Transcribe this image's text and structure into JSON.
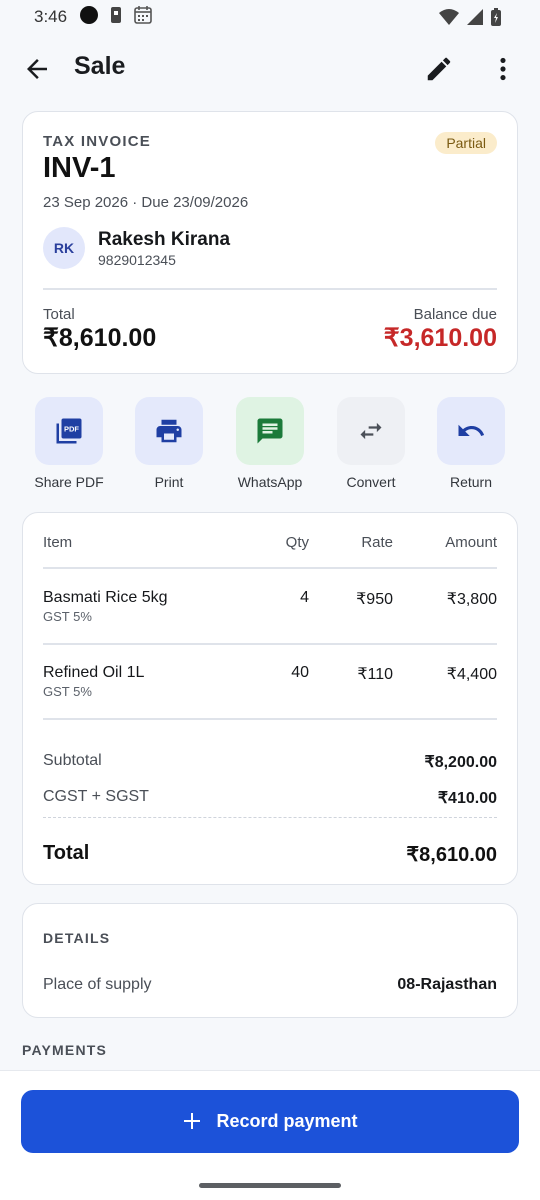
{
  "status_bar": {
    "time": "3:46",
    "icons": [
      "dot-icon",
      "sim-icon",
      "calendar-icon",
      "wifi-icon",
      "signal-icon",
      "battery-icon"
    ]
  },
  "app_bar": {
    "title": "Sale",
    "icons": [
      "back-arrow-icon",
      "pencil-icon",
      "more-vertical-icon"
    ]
  },
  "invoice": {
    "type_label": "TAX INVOICE",
    "status": "Partial",
    "number": "INV-1",
    "dates": "23 Sep 2026 · Due 23/09/2026",
    "customer": {
      "initials": "RK",
      "name": "Rakesh Kirana",
      "phone": "9829012345"
    },
    "total_label": "Total",
    "total_value": "₹8,610.00",
    "balance_label": "Balance due",
    "balance_value": "₹3,610.00"
  },
  "actions": [
    {
      "label": "Share PDF",
      "icon": "pdf-icon"
    },
    {
      "label": "Print",
      "icon": "printer-icon"
    },
    {
      "label": "WhatsApp",
      "icon": "chat-icon"
    },
    {
      "label": "Convert",
      "icon": "swap-icon"
    },
    {
      "label": "Return",
      "icon": "undo-icon"
    }
  ],
  "items_table": {
    "headers": [
      "Item",
      "Qty",
      "Rate",
      "Amount"
    ],
    "rows": [
      {
        "name": "Basmati Rice 5kg",
        "tax": "GST 5%",
        "qty": "4",
        "rate": "₹950",
        "amount": "₹3,800"
      },
      {
        "name": "Refined Oil 1L",
        "tax": "GST 5%",
        "qty": "40",
        "rate": "₹110",
        "amount": "₹4,400"
      }
    ],
    "subtotal_label": "Subtotal",
    "subtotal_value": "₹8,200.00",
    "tax_label": "CGST + SGST",
    "tax_value": "₹410.00",
    "total_label": "Total",
    "total_value": "₹8,610.00"
  },
  "details": {
    "title": "DETAILS",
    "place_of_supply_label": "Place of supply",
    "place_of_supply_value": "08-Rajasthan"
  },
  "payments": {
    "title": "PAYMENTS"
  },
  "record_button": {
    "label": "Record payment",
    "icon": "plus-icon"
  },
  "colors": {
    "accent": "#1c52d9",
    "balance_red": "#c62828",
    "badge_bg": "#fbeccb",
    "whatsapp_bg": "#dff3e3",
    "action_bg": "#e4e9fb"
  }
}
